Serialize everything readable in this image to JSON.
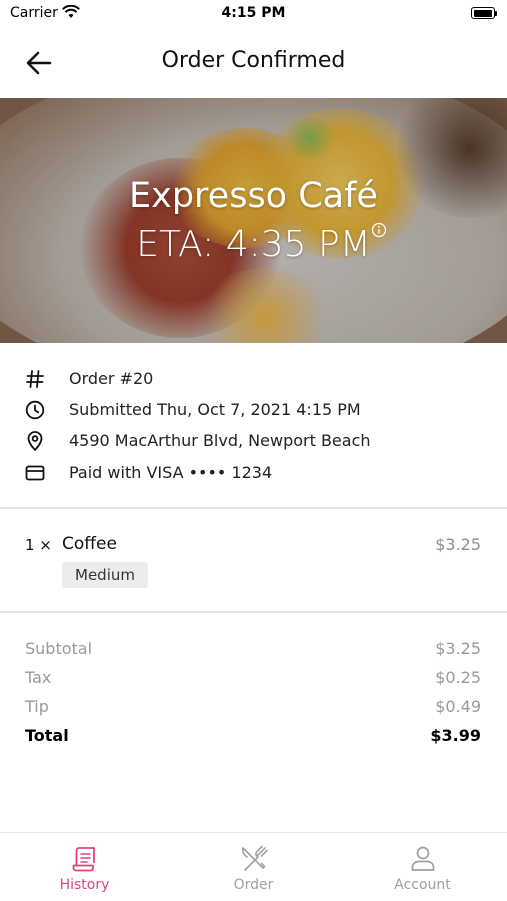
{
  "status_bar": {
    "carrier": "Carrier",
    "time": "4:15 PM"
  },
  "nav": {
    "title": "Order Confirmed"
  },
  "hero": {
    "restaurant_name": "Expresso Café",
    "eta": "ETA: 4:35 PM"
  },
  "details": {
    "order_number": "Order #20",
    "submitted": "Submitted Thu, Oct 7, 2021 4:15 PM",
    "address": "4590 MacArthur Blvd, Newport Beach",
    "payment": "Paid with VISA •••• 1234"
  },
  "items": [
    {
      "qty": "1 ×",
      "name": "Coffee",
      "price": "$3.25",
      "modifier": "Medium"
    }
  ],
  "totals": {
    "subtotal_label": "Subtotal",
    "subtotal": "$3.25",
    "tax_label": "Tax",
    "tax": "$0.25",
    "tip_label": "Tip",
    "tip": "$0.49",
    "total_label": "Total",
    "total": "$3.99"
  },
  "tabbar": {
    "tabs": [
      {
        "label": "History",
        "icon": "receipt-icon",
        "active": true
      },
      {
        "label": "Order",
        "icon": "fork-knife-icon",
        "active": false
      },
      {
        "label": "Account",
        "icon": "person-icon",
        "active": false
      }
    ]
  },
  "colors": {
    "accent": "#e0457a",
    "inactive": "#a0a0a0"
  }
}
